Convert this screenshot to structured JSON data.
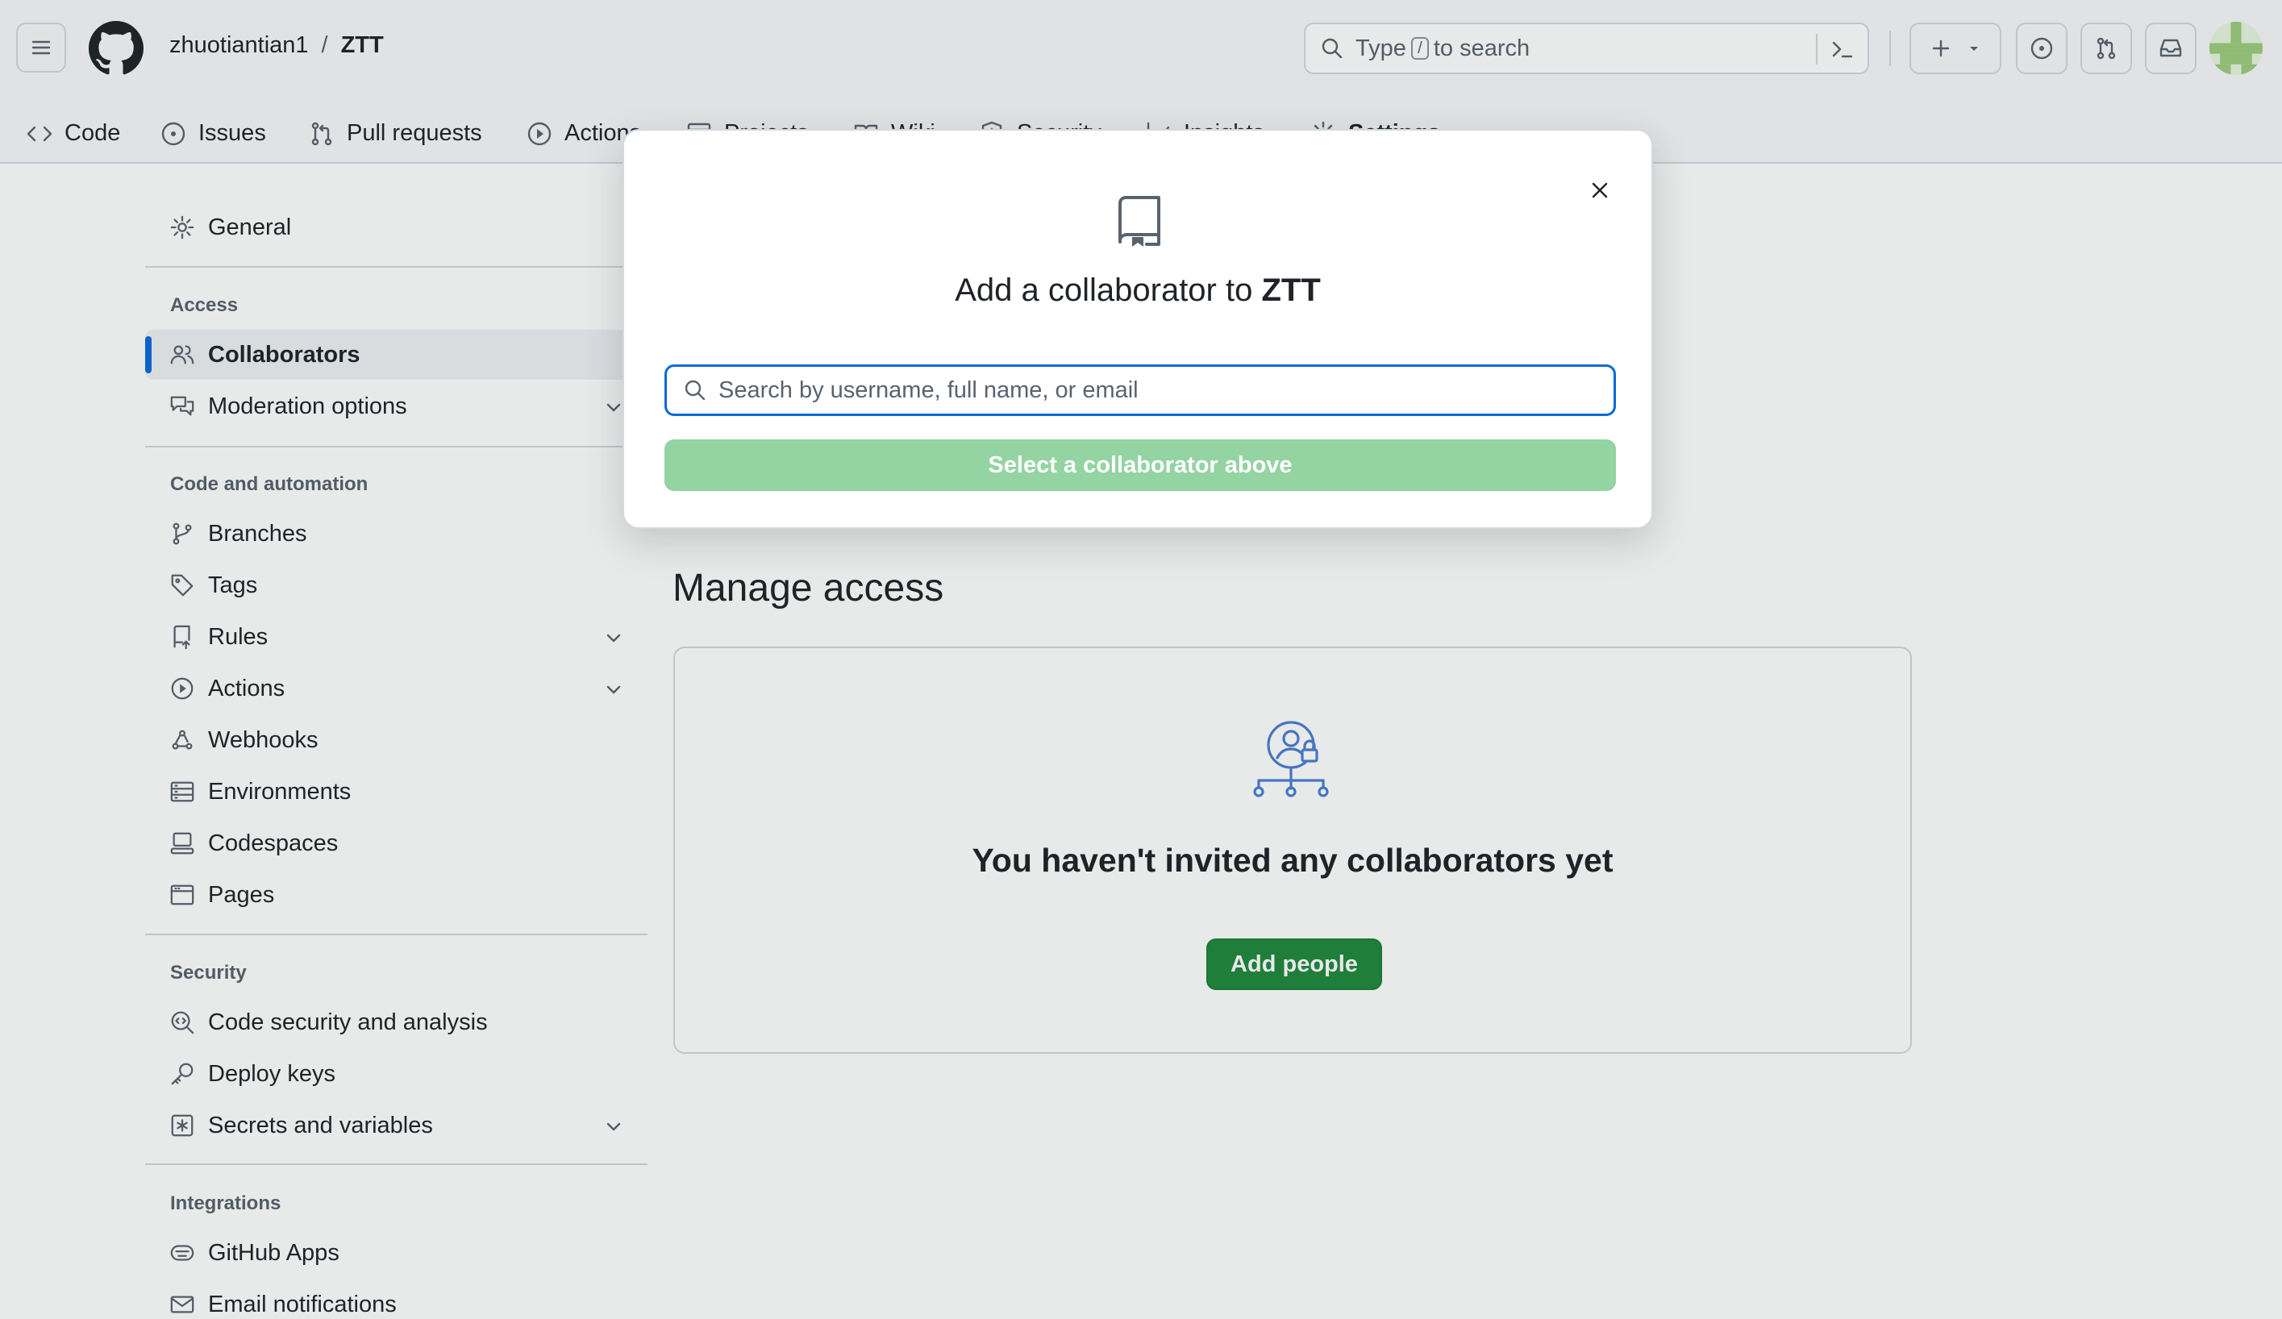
{
  "header": {
    "owner": "zhuotiantian1",
    "separator": "/",
    "repo": "ZTT",
    "search": {
      "prefix": "Type",
      "key": "/",
      "suffix": "to search"
    }
  },
  "tabs": [
    {
      "label": "Code",
      "icon": "code-icon"
    },
    {
      "label": "Issues",
      "icon": "issue-opened-icon"
    },
    {
      "label": "Pull requests",
      "icon": "git-pull-request-icon"
    },
    {
      "label": "Actions",
      "icon": "play-icon"
    },
    {
      "label": "Projects",
      "icon": "table-icon"
    },
    {
      "label": "Wiki",
      "icon": "book-icon"
    },
    {
      "label": "Security",
      "icon": "shield-icon"
    },
    {
      "label": "Insights",
      "icon": "graph-icon"
    },
    {
      "label": "Settings",
      "icon": "gear-icon",
      "active": true
    }
  ],
  "sidebar": {
    "general": "General",
    "access_heading": "Access",
    "collaborators": "Collaborators",
    "moderation": "Moderation options",
    "code_heading": "Code and automation",
    "branches": "Branches",
    "tags": "Tags",
    "rules": "Rules",
    "actions": "Actions",
    "webhooks": "Webhooks",
    "environments": "Environments",
    "codespaces": "Codespaces",
    "pages": "Pages",
    "security_heading": "Security",
    "code_security": "Code security and analysis",
    "deploy_keys": "Deploy keys",
    "secrets": "Secrets and variables",
    "integrations_heading": "Integrations",
    "github_apps": "GitHub Apps",
    "email_notifications": "Email notifications"
  },
  "main": {
    "manage_access_title": "Manage access",
    "empty_message": "You haven't invited any collaborators yet",
    "add_people_label": "Add people"
  },
  "modal": {
    "title_prefix": "Add a collaborator to",
    "title_repo": "ZTT",
    "search_placeholder": "Search by username, full name, or email",
    "submit_label": "Select a collaborator above"
  },
  "colors": {
    "accent_blue": "#0969da",
    "primary_green": "#1f883d",
    "disabled_green": "#94d3a2",
    "tab_underline": "#fd8c73"
  }
}
